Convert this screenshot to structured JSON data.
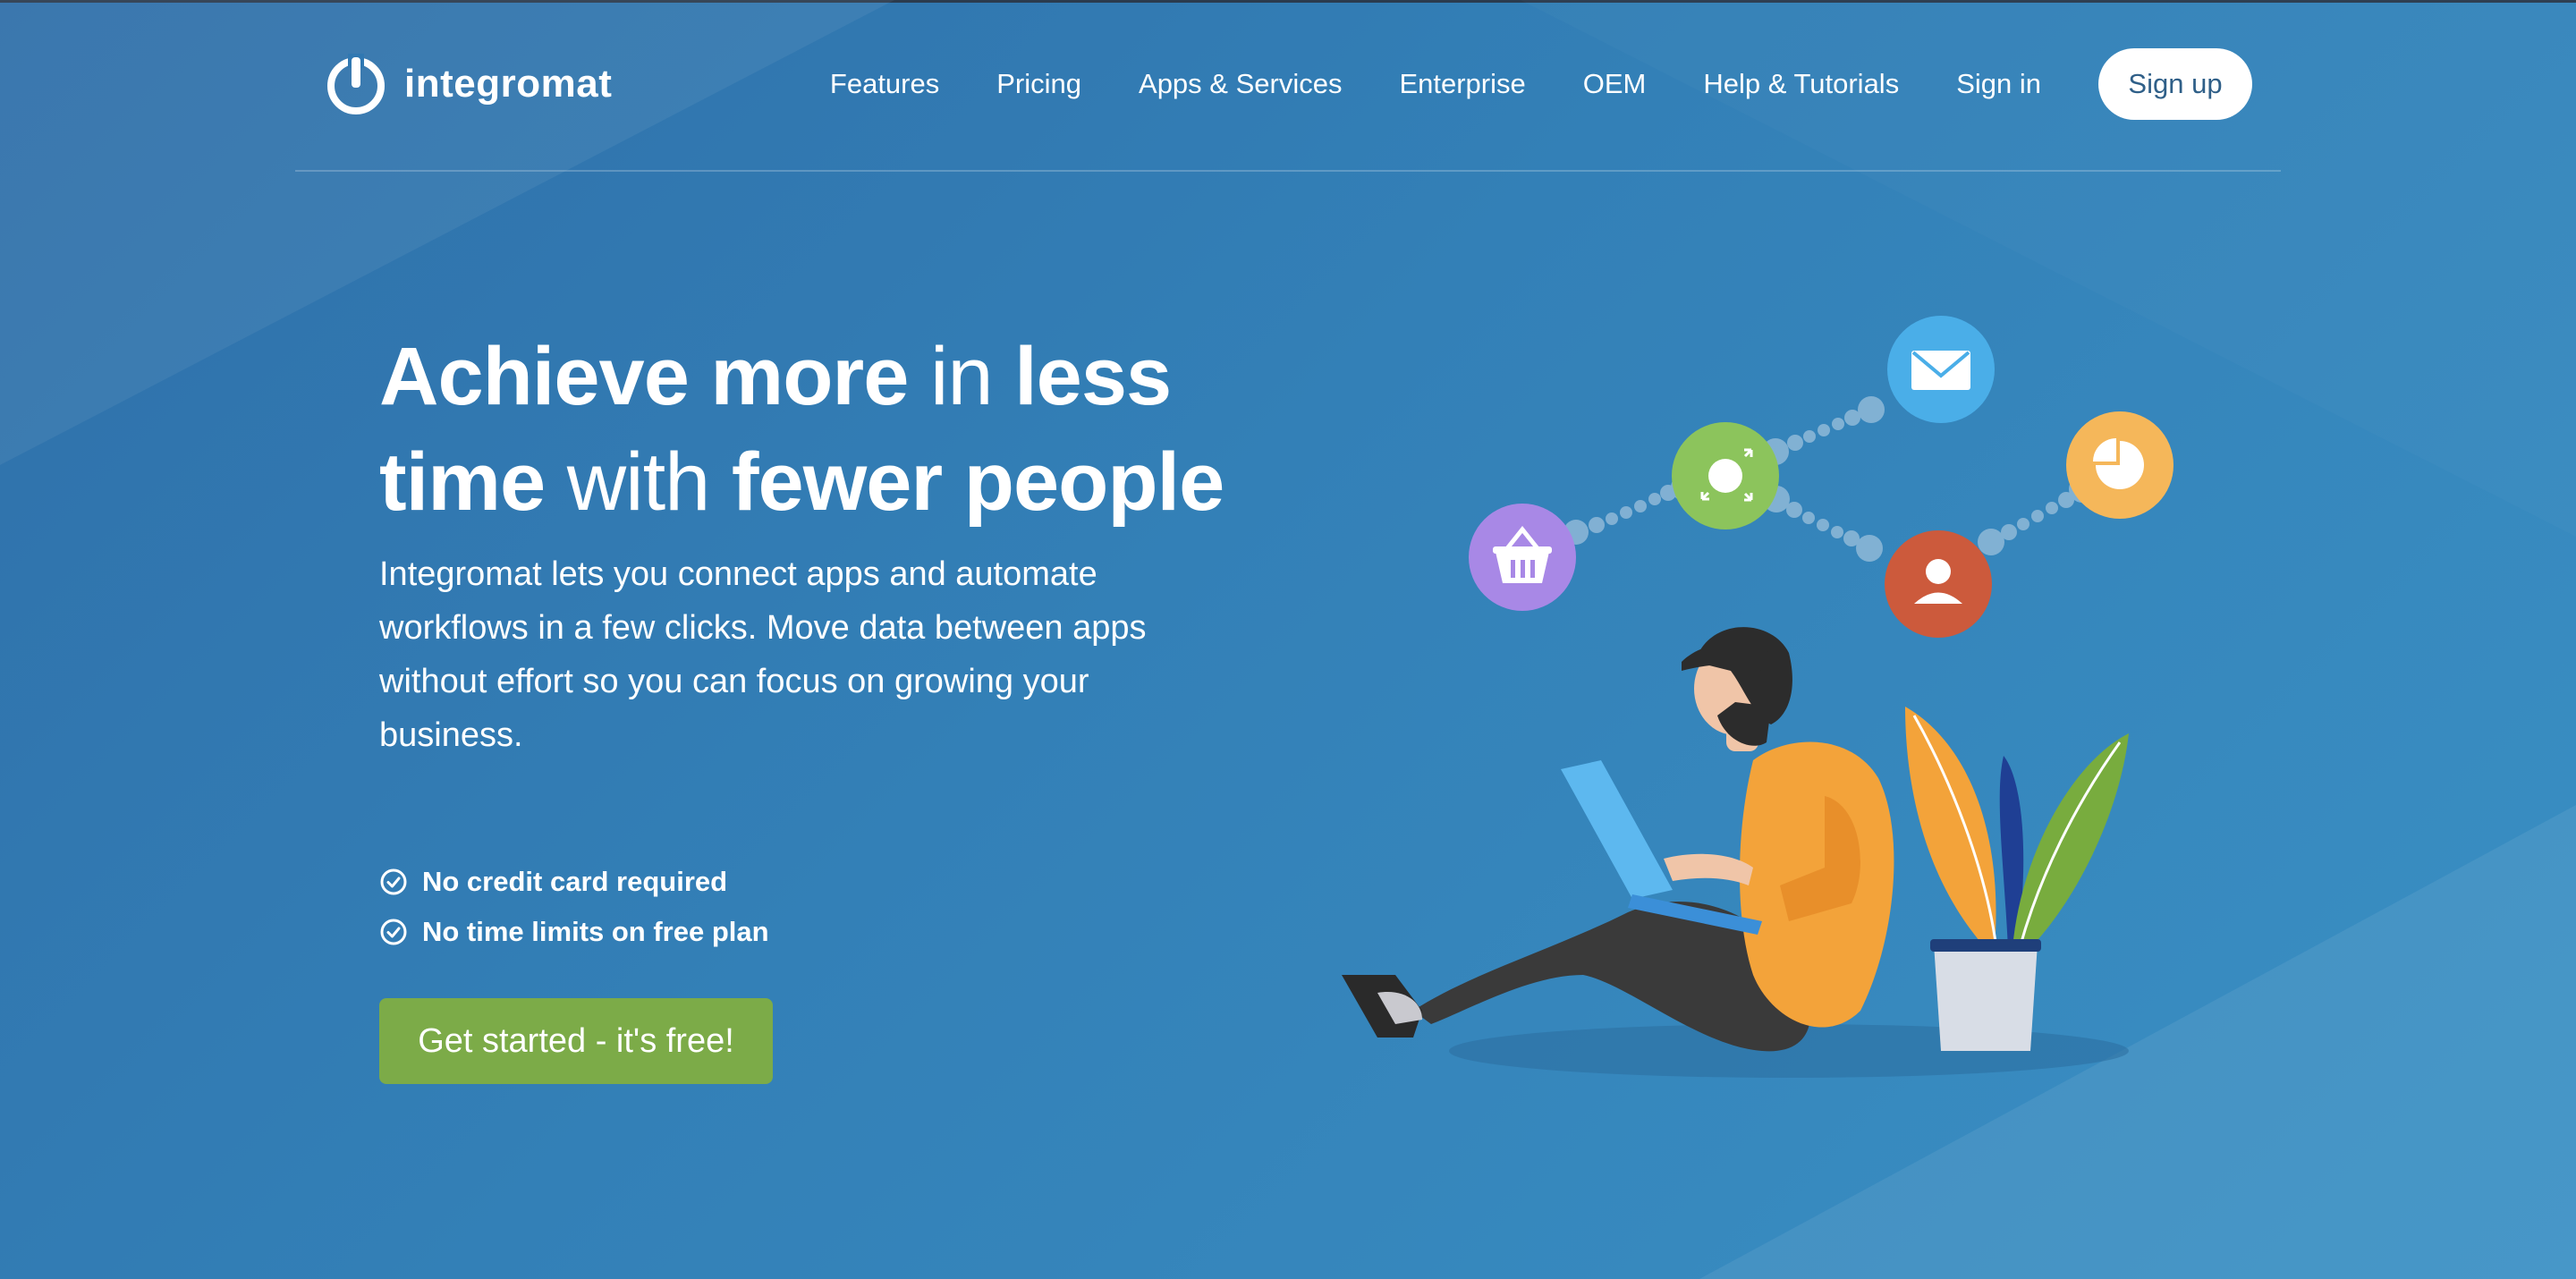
{
  "brand": {
    "name": "integromat"
  },
  "nav": {
    "items": [
      {
        "label": "Features"
      },
      {
        "label": "Pricing"
      },
      {
        "label": "Apps & Services"
      },
      {
        "label": "Enterprise"
      },
      {
        "label": "OEM"
      },
      {
        "label": "Help & Tutorials"
      },
      {
        "label": "Sign in"
      }
    ],
    "signup_label": "Sign up"
  },
  "hero": {
    "headline": {
      "p1": "Achieve more",
      "p2": " in ",
      "p3": "less time",
      "p4": " with ",
      "p5": "fewer people"
    },
    "description": "Integromat lets you connect apps and automate workflows in a few clicks. Move data between apps without effort so you can focus on growing your business.",
    "checks": [
      {
        "label": "No credit card required"
      },
      {
        "label": "No time limits on free plan"
      }
    ],
    "cta_label": "Get started - it's free!"
  },
  "colors": {
    "background": "#3380b7",
    "cta": "#7cab48",
    "signup_text": "#2f5f88",
    "node_basket": "#a888e6",
    "node_router": "#8cc45c",
    "node_mail": "#4aaee8",
    "node_user": "#cc5a3c",
    "node_chart": "#f5b75a",
    "shirt": "#f3a33a"
  },
  "icons": [
    "integromat-logo-icon",
    "check-circle-icon",
    "basket-icon",
    "router-icon",
    "mail-icon",
    "user-icon",
    "pie-chart-icon"
  ]
}
